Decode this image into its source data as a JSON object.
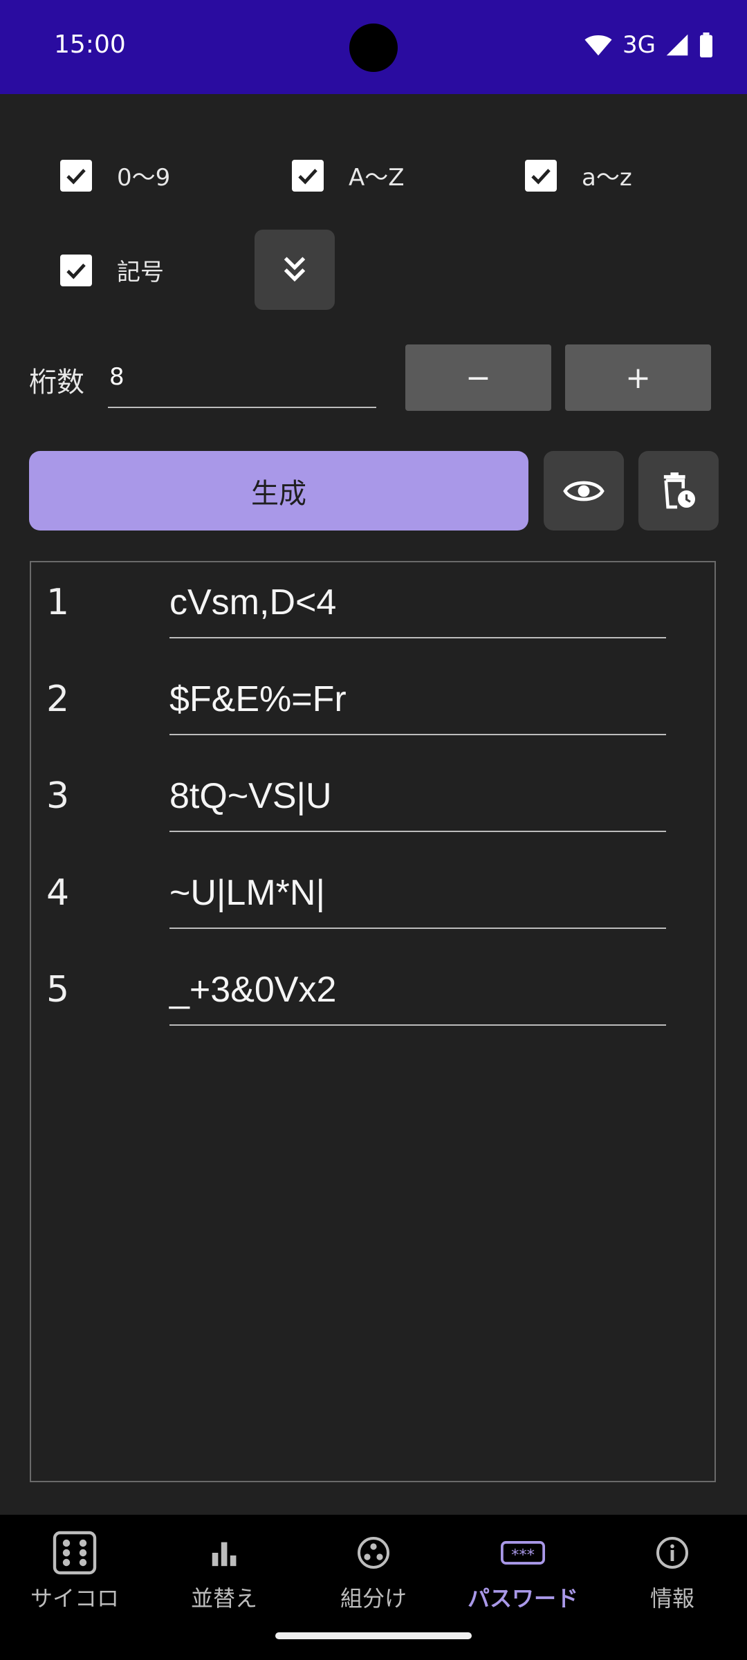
{
  "status_bar": {
    "time": "15:00",
    "network": "3G"
  },
  "options": {
    "digits_0_9": {
      "label": "0〜9",
      "checked": true
    },
    "upper_a_z": {
      "label": "A〜Z",
      "checked": true
    },
    "lower_a_z": {
      "label": "a〜z",
      "checked": true
    },
    "symbols": {
      "label": "記号",
      "checked": true
    }
  },
  "length": {
    "label": "桁数",
    "value": "8",
    "minus_label": "−",
    "plus_label": "+"
  },
  "generate_label": "生成",
  "results": [
    {
      "index": "1",
      "password": "cVsm,D<4"
    },
    {
      "index": "2",
      "password": "$F&E%=Fr"
    },
    {
      "index": "3",
      "password": "8tQ~VS|U"
    },
    {
      "index": "4",
      "password": "~U|LM*N|"
    },
    {
      "index": "5",
      "password": "_+3&0Vx2"
    }
  ],
  "nav": {
    "dice": "サイコロ",
    "sort": "並替え",
    "group": "組分け",
    "password": "パスワード",
    "info": "情報"
  },
  "colors": {
    "status_bar": "#2a0ca0",
    "accent": "#a998e8",
    "background": "#212121"
  }
}
